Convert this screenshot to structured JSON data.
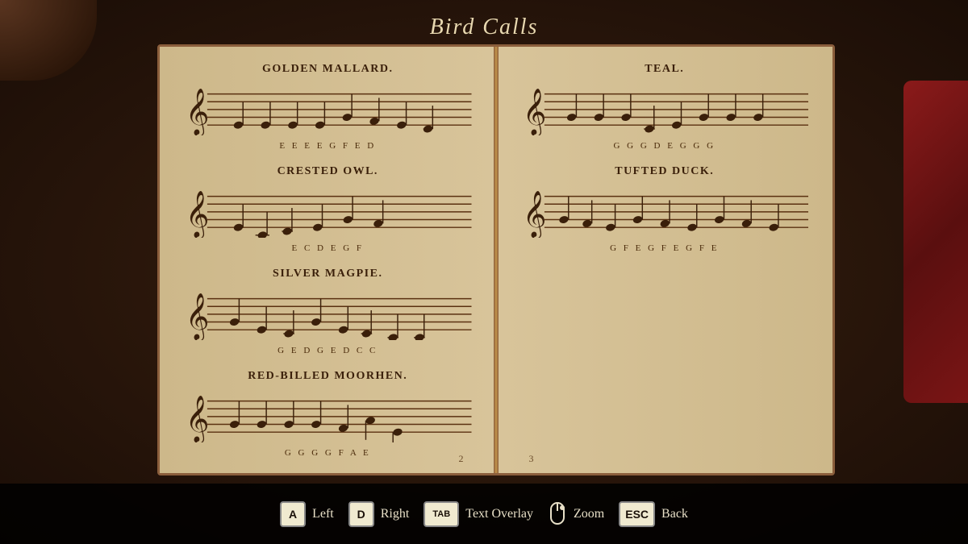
{
  "title": "Bird Calls",
  "book": {
    "page_left": {
      "number": "2",
      "birds": [
        {
          "name": "Golden Mallard.",
          "notes_display": "E  E  E  E  G  F  E  D"
        },
        {
          "name": "Crested Owl.",
          "notes_display": "E  C  D  E  G  F"
        },
        {
          "name": "Silver Magpie.",
          "notes_display": "G  E  D  G  E  D  C  C"
        },
        {
          "name": "Red-Billed Moorhen.",
          "notes_display": "G  G  G  G  F  A  E"
        }
      ]
    },
    "page_right": {
      "number": "3",
      "birds": [
        {
          "name": "Teal.",
          "notes_display": "G  G  G  D  E  G  G  G"
        },
        {
          "name": "Tufted Duck.",
          "notes_display": "G  F  E  G  F  E  G  F  E"
        }
      ]
    }
  },
  "controls": [
    {
      "key": "A",
      "label": "Left",
      "wide": false
    },
    {
      "key": "D",
      "label": "Right",
      "wide": false
    },
    {
      "key": "TAB",
      "label": "Text Overlay",
      "wide": true
    },
    {
      "key": "MOUSE",
      "label": "Zoom",
      "wide": false
    },
    {
      "key": "ESC",
      "label": "Back",
      "wide": false
    }
  ]
}
